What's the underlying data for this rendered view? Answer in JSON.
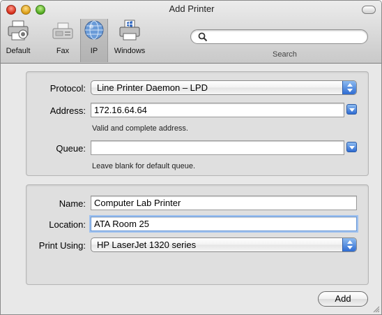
{
  "window": {
    "title": "Add Printer"
  },
  "toolbar": {
    "items": [
      {
        "label": "Default",
        "icon": "default-printer-icon"
      },
      {
        "label": "Fax",
        "icon": "fax-icon"
      },
      {
        "label": "IP",
        "icon": "ip-globe-icon",
        "selected": true
      },
      {
        "label": "Windows",
        "icon": "windows-printer-icon"
      }
    ],
    "search": {
      "placeholder": "",
      "value": "",
      "label": "Search"
    }
  },
  "connection": {
    "protocol_label": "Protocol:",
    "protocol_value": "Line Printer Daemon – LPD",
    "address_label": "Address:",
    "address_value": "172.16.64.64",
    "address_hint": "Valid and complete address.",
    "queue_label": "Queue:",
    "queue_value": "",
    "queue_hint": "Leave blank for default queue."
  },
  "details": {
    "name_label": "Name:",
    "name_value": "Computer Lab Printer",
    "location_label": "Location:",
    "location_value": "ATA Room 25",
    "print_using_label": "Print Using:",
    "print_using_value": "HP LaserJet 1320 series"
  },
  "actions": {
    "add_label": "Add"
  },
  "colors": {
    "accent": "#3a78d8",
    "focus_ring": "#9ec1ef"
  }
}
